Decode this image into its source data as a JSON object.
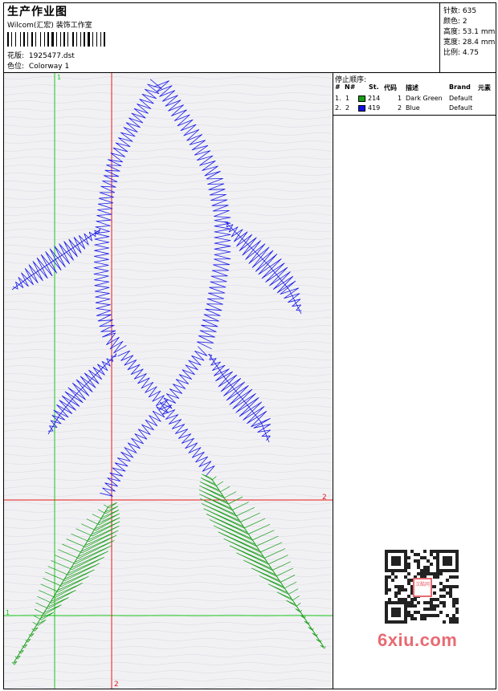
{
  "header": {
    "title": "生产作业图",
    "studio": "Wilcom(汇宏) 装饰工作室",
    "design_label": "花版:",
    "design_file": "1925477.dst",
    "colorway_label": "色位:",
    "colorway": "Colorway 1"
  },
  "stats": [
    {
      "label": "针数:",
      "value": "635"
    },
    {
      "label": "颜色:",
      "value": "2"
    },
    {
      "label": "高度:",
      "value": "53.1 mm"
    },
    {
      "label": "宽度:",
      "value": "28.4 mm"
    },
    {
      "label": "比例:",
      "value": "4.75"
    }
  ],
  "stop_sequence": {
    "title": "停止顺序:",
    "headers": [
      "#",
      "N#",
      "St.",
      "代码",
      "描述",
      "Brand",
      "元素"
    ],
    "rows": [
      {
        "idx": "1.",
        "n": "1",
        "code": "214",
        "st": "1",
        "desc": "Dark Green",
        "brand": "Default",
        "color": "#1a9e1a"
      },
      {
        "idx": "2.",
        "n": "2",
        "code": "419",
        "st": "2",
        "desc": "Blue",
        "brand": "Default",
        "color": "#1010e6"
      }
    ]
  },
  "canvas": {
    "marker_1_top": "1",
    "marker_1_left": "1",
    "marker_2_right": "2",
    "marker_2_bottom": "2",
    "guide_green": "#19c819",
    "guide_red": "#e61919",
    "stitch_blue": "#1a1ae6",
    "stitch_green": "#1a9e1a"
  },
  "watermark": {
    "qr_center": "汉酷网",
    "logo": "6xiu.com"
  }
}
